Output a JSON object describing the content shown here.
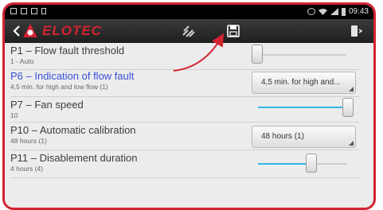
{
  "status_bar": {
    "time": "09:43",
    "left_icons": [
      "notification-icon",
      "mail-icon",
      "image-icon",
      "sd-card-icon"
    ],
    "right_icons": [
      "alarm-icon",
      "wifi-icon",
      "signal-icon",
      "battery-icon"
    ]
  },
  "app_bar": {
    "brand": "ELOTEC",
    "icons": [
      "back-icon",
      "elotec-logo-icon",
      "satellite-icon",
      "save-icon",
      "device-menu-icon"
    ]
  },
  "settings": [
    {
      "title": "P1 – Flow fault threshold",
      "subtitle": "1 - Auto",
      "control": "slider",
      "level": 0.0
    },
    {
      "title": "P6 – Indication of flow fault",
      "subtitle": "4,5 min. for high and low flow (1)",
      "control": "dropdown",
      "value": "4,5 min. for high and...",
      "selected": true
    },
    {
      "title": "P7 – Fan speed",
      "subtitle": "10",
      "control": "slider",
      "level": 1.0
    },
    {
      "title": "P10 – Automatic calibration",
      "subtitle": "48 hours (1)",
      "control": "dropdown",
      "value": "48 hours (1)"
    },
    {
      "title": "P11 – Disablement duration",
      "subtitle": "4 hours (4)",
      "control": "slider",
      "level": 0.6
    }
  ],
  "colors": {
    "frame": "#d32330",
    "selected_title": "#3b4fd8",
    "slider_track": "#33b5e5",
    "slider_track_empty": "#cfcfcf",
    "annotation_arrow": "#d32330"
  }
}
